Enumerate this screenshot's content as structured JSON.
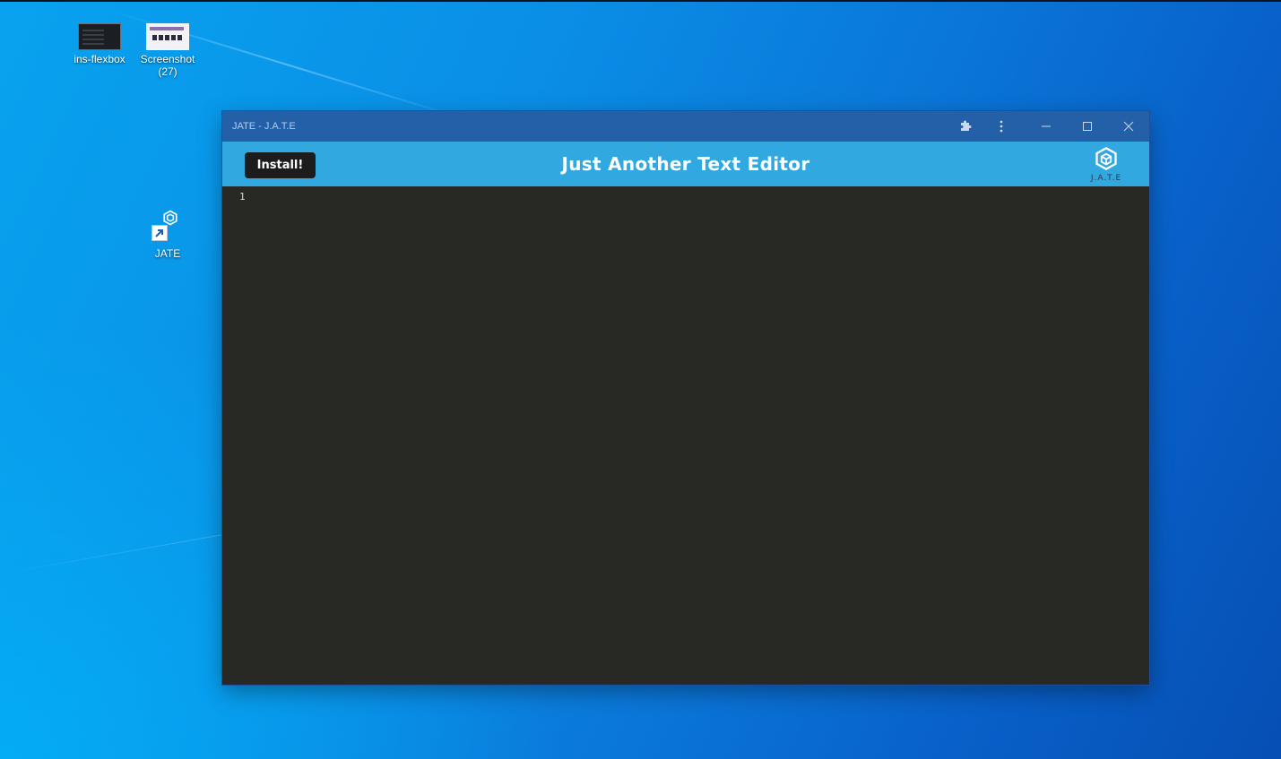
{
  "desktop": {
    "icons": [
      {
        "label": "ins-flexbox"
      },
      {
        "label": "Screenshot (27)"
      },
      {
        "label": "JATE"
      }
    ]
  },
  "window": {
    "title": "JATE - J.A.T.E",
    "controls": {
      "extensions": "puzzle-icon",
      "menu": "more-vertical-icon",
      "minimize": "minimize-icon",
      "maximize": "maximize-icon",
      "close": "close-icon"
    }
  },
  "header": {
    "install_label": "Install!",
    "title": "Just Another Text Editor",
    "logo_text": "J.A.T.E"
  },
  "editor": {
    "line_numbers": [
      "1"
    ],
    "content": ""
  },
  "colors": {
    "titlebar": "#2360a8",
    "header": "#32a8e0",
    "editor_bg": "#282824",
    "install_btn": "#1c1c1c"
  }
}
